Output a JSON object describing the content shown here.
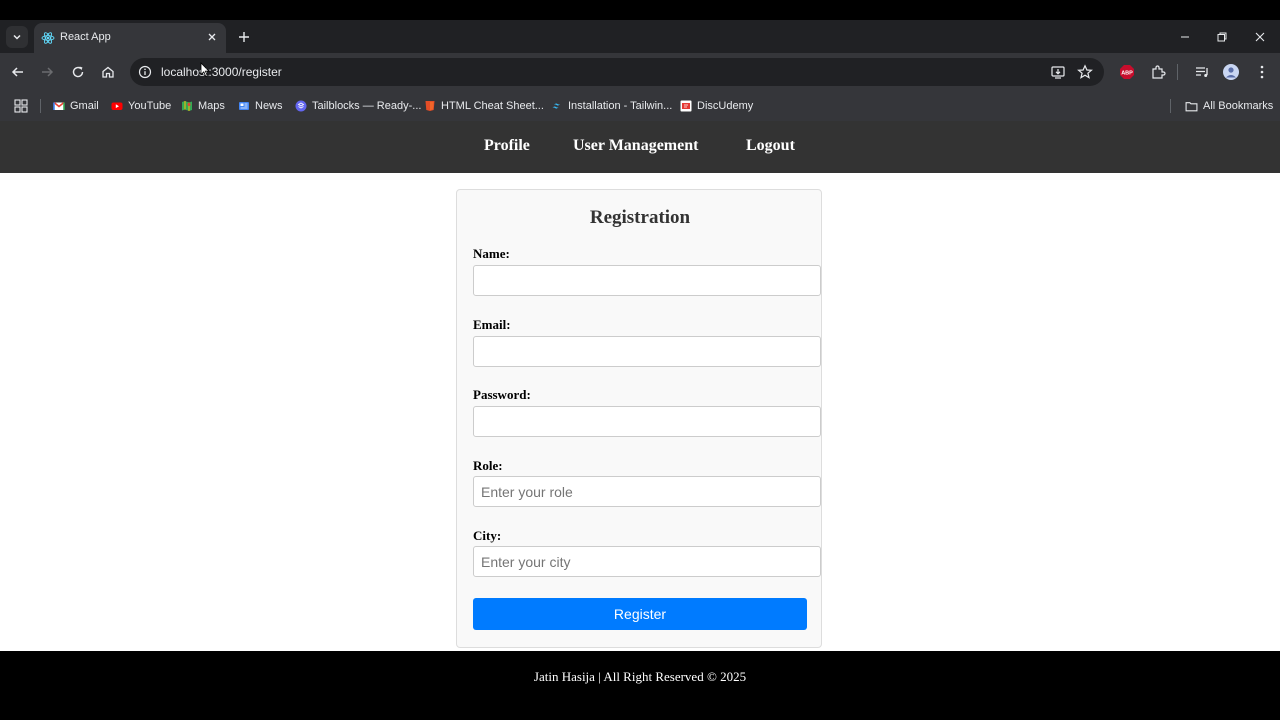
{
  "browser": {
    "tab": {
      "title": "React App"
    },
    "address_bar": {
      "url": "localhost:3000/register"
    },
    "bookmarks": [
      {
        "label": "Gmail",
        "icon": "gmail-icon",
        "color": "#ea4335"
      },
      {
        "label": "YouTube",
        "icon": "youtube-icon",
        "color": "#ff0000"
      },
      {
        "label": "Maps",
        "icon": "maps-icon",
        "color": "#34a853"
      },
      {
        "label": "News",
        "icon": "news-icon",
        "color": "#4285f4"
      },
      {
        "label": "Tailblocks — Ready-...",
        "icon": "tailblocks-icon",
        "color": "#6366f1"
      },
      {
        "label": "HTML Cheat Sheet...",
        "icon": "html5-icon",
        "color": "#e44d26"
      },
      {
        "label": "Installation - Tailwin...",
        "icon": "tailwind-icon",
        "color": "#38bdf8"
      },
      {
        "label": "DiscUdemy",
        "icon": "discudemy-icon",
        "color": "#e53935"
      }
    ],
    "all_bookmarks_label": "All Bookmarks",
    "adblock_badge": "ABP"
  },
  "app": {
    "nav": [
      {
        "label": "Profile"
      },
      {
        "label": "User Management"
      },
      {
        "label": "Logout"
      }
    ],
    "form": {
      "title": "Registration",
      "fields": [
        {
          "label": "Name:",
          "placeholder": "",
          "value": ""
        },
        {
          "label": "Email:",
          "placeholder": "",
          "value": ""
        },
        {
          "label": "Password:",
          "placeholder": "",
          "value": ""
        },
        {
          "label": "Role:",
          "placeholder": "Enter your role",
          "value": ""
        },
        {
          "label": "City:",
          "placeholder": "Enter your city",
          "value": ""
        }
      ],
      "submit_label": "Register"
    },
    "footer": {
      "text": "Jatin Hasija | All Right Reserved © 2025"
    }
  },
  "colors": {
    "chrome_dark": "#202124",
    "chrome_toolbar": "#35363a",
    "app_nav_bg": "#333333",
    "primary_button": "#007bff",
    "footer_bg": "#000000"
  }
}
